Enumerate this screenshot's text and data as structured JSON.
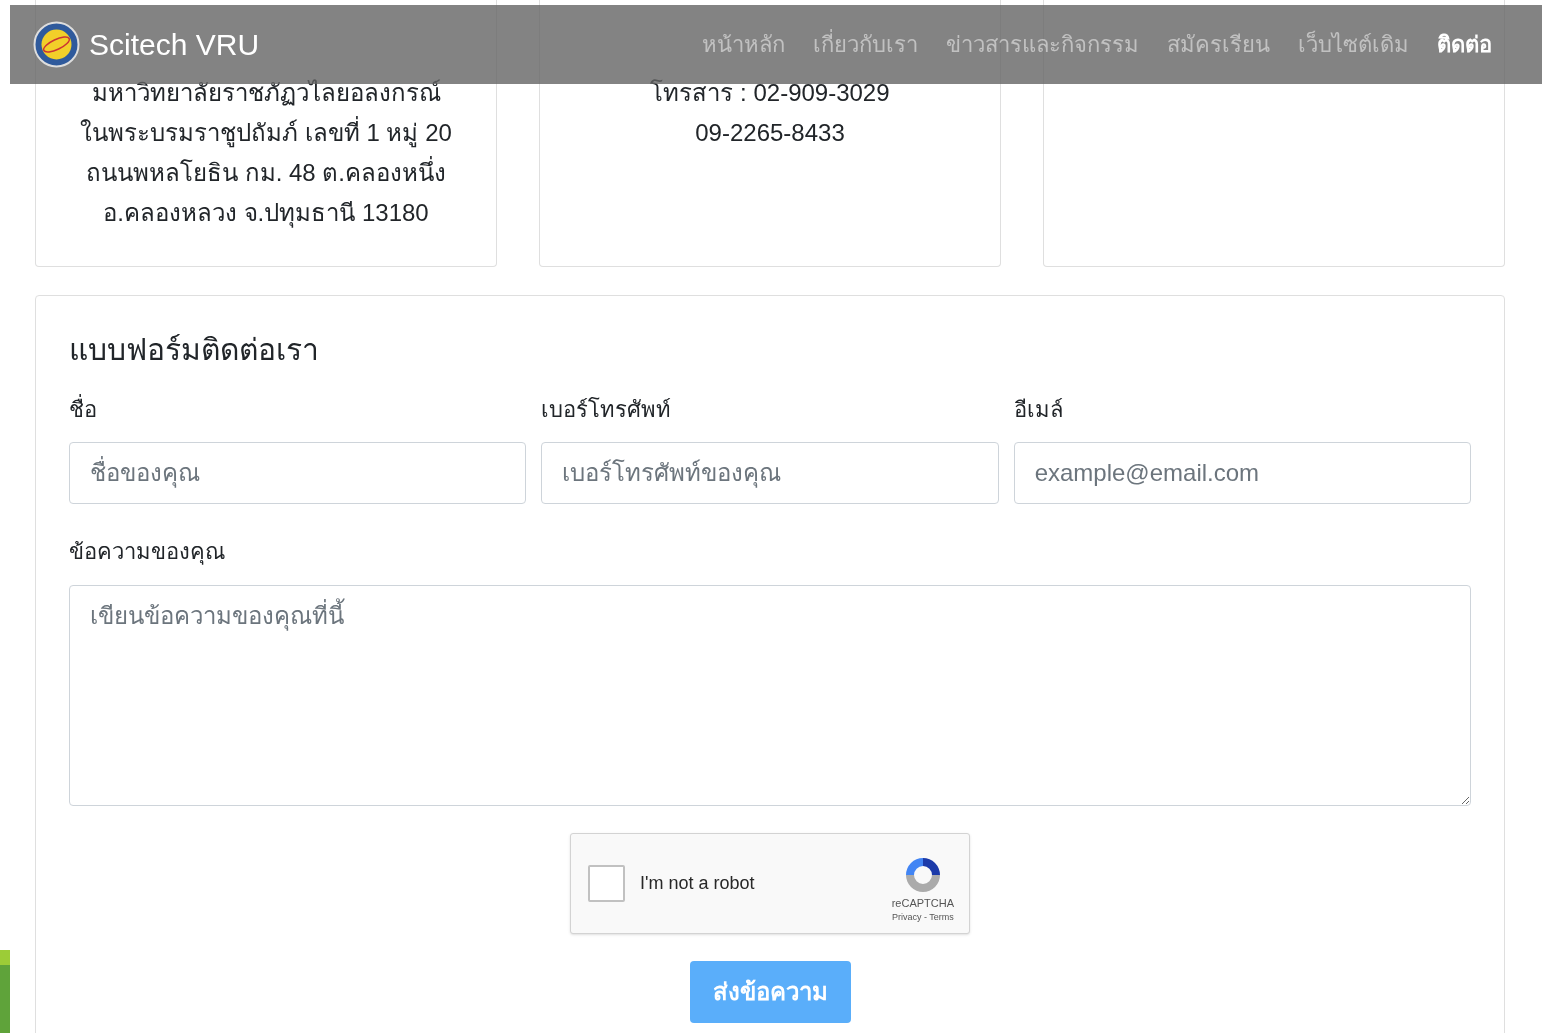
{
  "navbar": {
    "brand": "Scitech VRU",
    "items": [
      {
        "label": "หน้าหลัก",
        "selected": false
      },
      {
        "label": "เกี่ยวกับเรา",
        "selected": false
      },
      {
        "label": "ข่าวสารและกิจกรรม",
        "selected": false
      },
      {
        "label": "สมัครเรียน",
        "selected": false
      },
      {
        "label": "เว็บไซต์เดิม",
        "selected": false
      },
      {
        "label": "ติดต่อ",
        "selected": true
      }
    ]
  },
  "info_cards": [
    {
      "lines": [
        "มหาวิทยาลัยราชภัฏวไลยอลงกรณ์",
        "ในพระบรมราชูปถัมภ์ เลขที่ 1 หมู่ 20",
        "ถนนพหลโยธิน กม. 48 ต.คลองหนึ่ง",
        "อ.คลองหลวง จ.ปทุมธานี 13180"
      ]
    },
    {
      "lines": [
        "โทรสาร : 02-909-3029",
        "09-2265-8433"
      ]
    }
  ],
  "contact_form": {
    "title": "แบบฟอร์มติดต่อเรา",
    "fields": [
      {
        "label": "ชื่อ",
        "placeholder": "ชื่อของคุณ"
      },
      {
        "label": "เบอร์โทรศัพท์",
        "placeholder": "เบอร์โทรศัพท์ของคุณ"
      },
      {
        "label": "อีเมล์",
        "placeholder": "example@email.com"
      }
    ],
    "message": {
      "label": "ข้อความของคุณ",
      "placeholder": "เขียนข้อความของคุณที่นี้"
    },
    "captcha": {
      "label": "I'm not a robot",
      "checked": false,
      "brand": "reCAPTCHA",
      "links": "Privacy - Terms"
    },
    "submit": "ส่งข้อความ"
  }
}
